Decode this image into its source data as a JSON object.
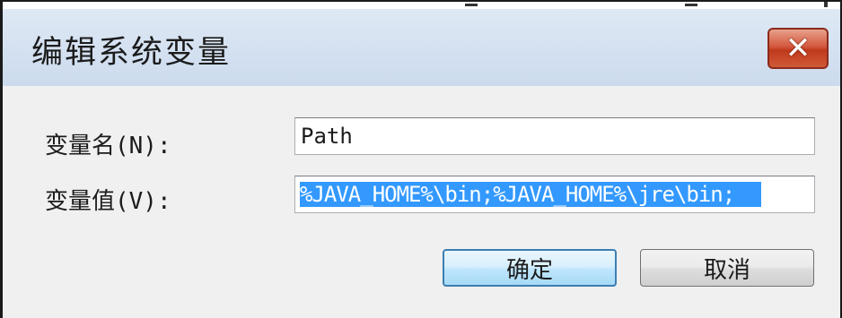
{
  "window": {
    "title": "编辑系统变量",
    "close_glyph": "✕"
  },
  "form": {
    "name_label": "变量名(N):",
    "name_value": "Path",
    "value_label": "变量值(V):",
    "value_value": "%JAVA_HOME%\\bin;%JAVA_HOME%\\jre\\bin;"
  },
  "buttons": {
    "ok_label": "确定",
    "cancel_label": "取消"
  },
  "colors": {
    "selection": "#3399ff",
    "close_button": "#c03a1c",
    "titlebar": "#cbdaed"
  }
}
